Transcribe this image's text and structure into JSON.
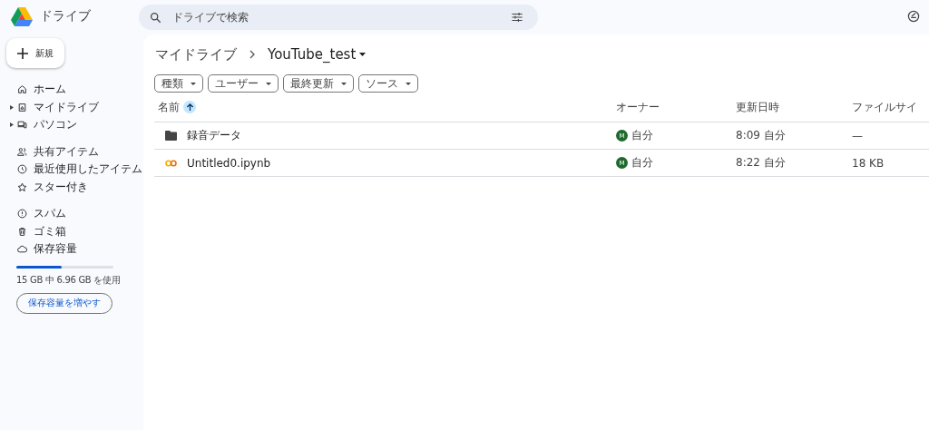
{
  "app": {
    "title": "ドライブ"
  },
  "search": {
    "placeholder": "ドライブで検索"
  },
  "new_button": {
    "label": "新規"
  },
  "sidebar": {
    "sections": [
      [
        {
          "label": "ホーム",
          "expandable": false
        },
        {
          "label": "マイドライブ",
          "expandable": true
        },
        {
          "label": "パソコン",
          "expandable": true
        }
      ],
      [
        {
          "label": "共有アイテム",
          "expandable": false
        },
        {
          "label": "最近使用したアイテム",
          "expandable": false
        },
        {
          "label": "スター付き",
          "expandable": false
        }
      ],
      [
        {
          "label": "スパム",
          "expandable": false
        },
        {
          "label": "ゴミ箱",
          "expandable": false
        },
        {
          "label": "保存容量",
          "expandable": false
        }
      ]
    ]
  },
  "storage": {
    "level": 0.47,
    "usage": "15 GB 中 6.96 GB を使用",
    "button": "保存容量を増やす"
  },
  "breadcrumb": {
    "parent": "マイドライブ",
    "current": "YouTube_test"
  },
  "filters": [
    "種類",
    "ユーザー",
    "最終更新",
    "ソース"
  ],
  "table": {
    "columns": [
      "名前",
      "オーナー",
      "更新日時",
      "ファイルサイ"
    ],
    "rows": [
      {
        "kind": "folder",
        "name": "録音データ",
        "avatar": "M",
        "owner": "自分",
        "modified": "8:09 自分",
        "size": "—"
      },
      {
        "kind": "notebook",
        "name": "Untitled0.ipynb",
        "avatar": "M",
        "owner": "自分",
        "modified": "8:22 自分",
        "size": "18 KB"
      }
    ]
  }
}
